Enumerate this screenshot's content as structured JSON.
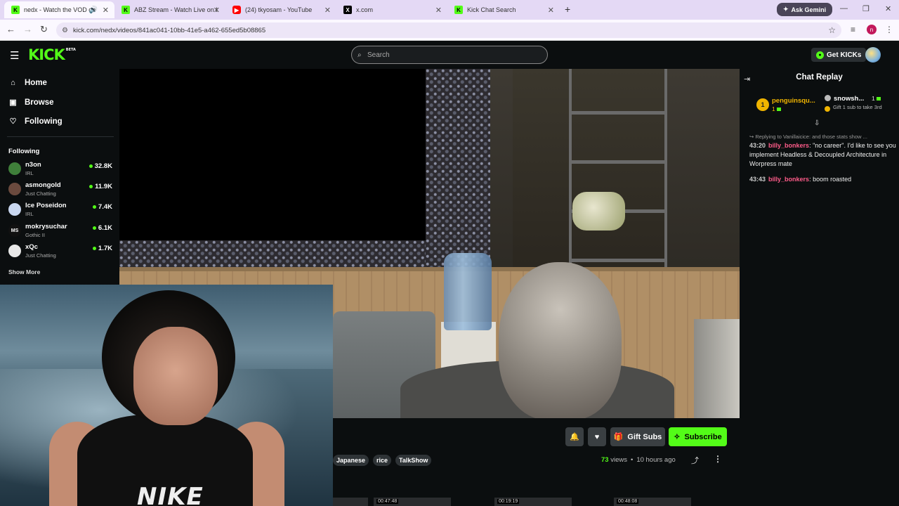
{
  "browser": {
    "tabs": [
      {
        "title": "nedx - Watch the VOD on K",
        "icon": "kick",
        "active": true,
        "audio": true
      },
      {
        "title": "ABZ Stream - Watch Live on Kic",
        "icon": "kick",
        "active": false
      },
      {
        "title": "(24) tkyosam - YouTube",
        "icon": "youtube",
        "active": false
      },
      {
        "title": "x.com",
        "icon": "x",
        "active": false
      },
      {
        "title": "Kick Chat Search",
        "icon": "kick",
        "active": false
      }
    ],
    "gemini_label": "Ask Gemini",
    "url": "kick.com/nedx/videos/841ac041-10bb-41e5-a462-655ed5b08865",
    "profile_initial": "n"
  },
  "header": {
    "logo": "KICK",
    "logo_tag": "BETA",
    "search_placeholder": "Search",
    "get_kicks_label": "Get KICKs"
  },
  "sidebar": {
    "nav": [
      {
        "label": "Home",
        "icon": "home-icon"
      },
      {
        "label": "Browse",
        "icon": "browse-icon"
      },
      {
        "label": "Following",
        "icon": "heart-icon"
      }
    ],
    "following_header": "Following",
    "channels": [
      {
        "name": "n3on",
        "category": "IRL",
        "viewers": "32.8K",
        "avatar_color": "#3f7f3a"
      },
      {
        "name": "asmongold",
        "category": "Just Chatting",
        "viewers": "11.9K",
        "avatar_color": "#6b4a3e"
      },
      {
        "name": "Ice Poseidon",
        "category": "IRL",
        "viewers": "7.4K",
        "avatar_color": "#c9d7f0"
      },
      {
        "name": "mokrysuchar",
        "category": "Gothic II",
        "viewers": "6.1K",
        "avatar_color": "#111111",
        "avatar_text": "MS"
      },
      {
        "name": "xQc",
        "category": "Just Chatting",
        "viewers": "1.7K",
        "avatar_color": "#e8e8e8"
      }
    ],
    "show_more": "Show More"
  },
  "video": {
    "webcam_shirt_text": "NIKE"
  },
  "actions": {
    "gift_label": "Gift Subs",
    "subscribe_label": "Subscribe"
  },
  "tags": [
    "Japanese",
    "rice",
    "TalkShow"
  ],
  "meta": {
    "views_count": "73",
    "views_label": "views",
    "separator": "•",
    "time_ago": "10 hours ago"
  },
  "thumbnails": [
    "00:47:48",
    "00:19:19",
    "00:48:08"
  ],
  "chat": {
    "title": "Chat Replay",
    "pinned": {
      "top_user": "penguinsqu...",
      "top_rank": "1",
      "top_count": "1",
      "second_user": "snowsh...",
      "second_count": "1",
      "second_sub": "Gift 1 sub to take 3rd"
    },
    "reply_to": "Replying to Vanillaicice: and those stats show ...",
    "messages": [
      {
        "time": "43:20",
        "user": "billy_bonkers",
        "text": "\"no career\". I'd like to see you implement Headless & Decoupled Architecture in Worpress mate"
      },
      {
        "time": "43:43",
        "user": "billy_bonkers",
        "text": "boom roasted"
      }
    ]
  },
  "colors": {
    "kick_green": "#53fc18",
    "background": "#0b0e0f",
    "chat_user": "#ff5c8a",
    "gold": "#f0b400"
  }
}
